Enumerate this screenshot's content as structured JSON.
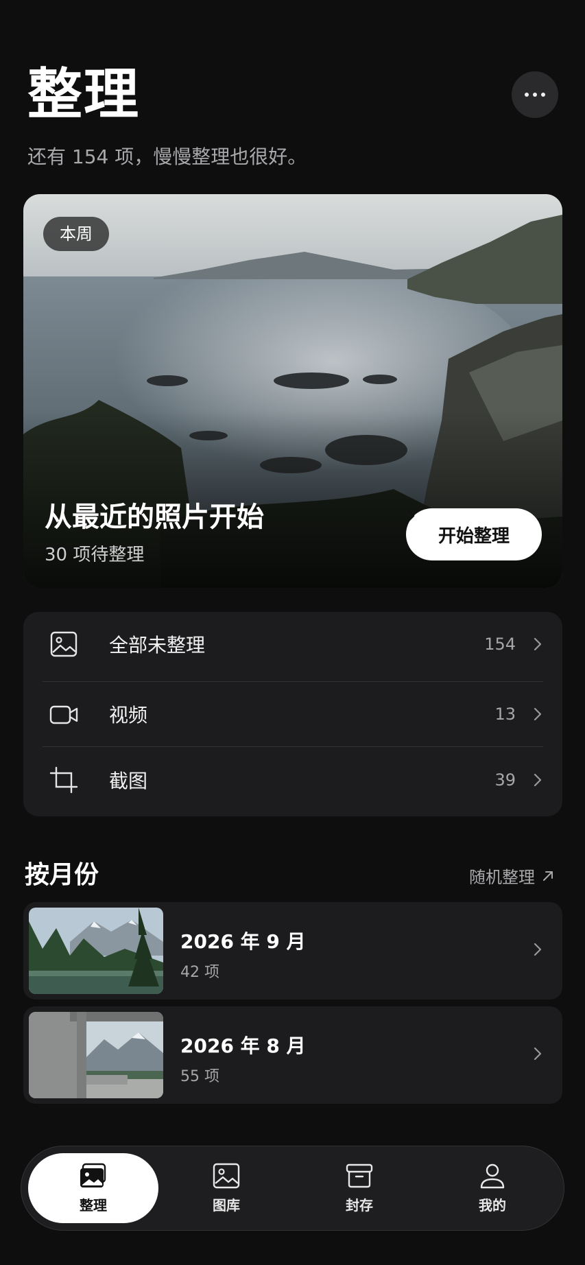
{
  "header": {
    "title": "整理",
    "subtitle": "还有 154 项，慢慢整理也很好。",
    "more_icon": "more-horizontal-icon"
  },
  "hero": {
    "tag": "本周",
    "title": "从最近的照片开始",
    "subtitle": "30 项待整理",
    "button_label": "开始整理"
  },
  "categories": [
    {
      "icon": "image-icon",
      "label": "全部未整理",
      "count": "154"
    },
    {
      "icon": "video-icon",
      "label": "视频",
      "count": "13"
    },
    {
      "icon": "crop-icon",
      "label": "截图",
      "count": "39"
    }
  ],
  "months_section": {
    "title": "按月份",
    "random_label": "随机整理"
  },
  "months": [
    {
      "title": "2026 年 9 月",
      "count": "42 项"
    },
    {
      "title": "2026 年 8 月",
      "count": "55 项"
    }
  ],
  "tabbar": [
    {
      "label": "整理",
      "icon": "photo-stack-icon",
      "active": true
    },
    {
      "label": "图库",
      "icon": "gallery-icon",
      "active": false
    },
    {
      "label": "封存",
      "icon": "archive-box-icon",
      "active": false
    },
    {
      "label": "我的",
      "icon": "person-icon",
      "active": false
    }
  ]
}
